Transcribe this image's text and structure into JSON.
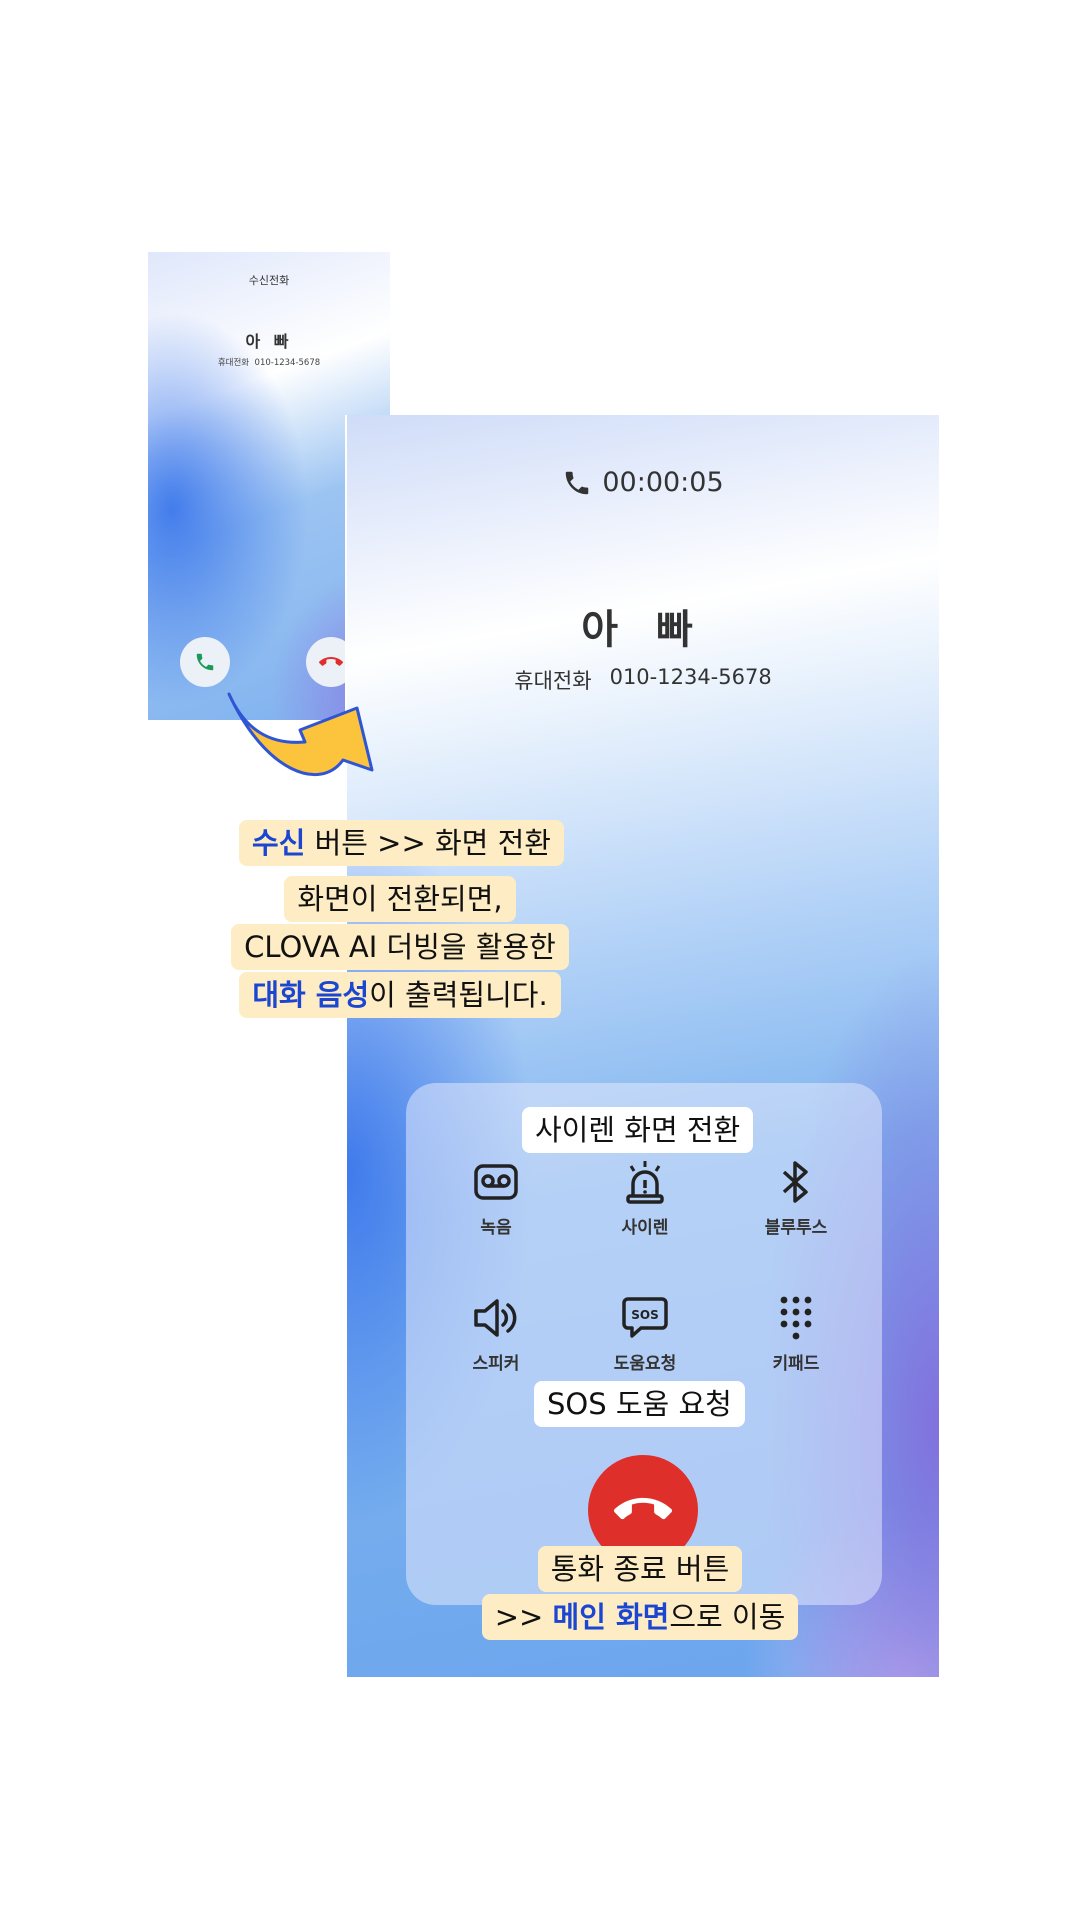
{
  "incoming": {
    "title": "수신전화",
    "caller_name": "아 빠",
    "number_type": "휴대전화",
    "number": "010-1234-5678",
    "icons": [
      "phone-accept-icon",
      "phone-decline-icon"
    ]
  },
  "call": {
    "timer": "00:00:05",
    "caller_name": "아 빠",
    "number_type": "휴대전화",
    "number": "010-1234-5678",
    "controls": [
      {
        "label": "녹음",
        "icon": "voicemail-icon"
      },
      {
        "label": "사이렌",
        "icon": "siren-icon"
      },
      {
        "label": "블루투스",
        "icon": "bluetooth-icon"
      },
      {
        "label": "스피커",
        "icon": "speaker-icon"
      },
      {
        "label": "도움요청",
        "icon": "sos-icon"
      },
      {
        "label": "키패드",
        "icon": "keypad-icon"
      }
    ],
    "end_icon": "hang-up-icon"
  },
  "annotations": {
    "accept": {
      "highlight": "수신",
      "rest": " 버튼 >> 화면 전환"
    },
    "transition": {
      "line1": "화면이 전환되면,",
      "line2": "CLOVA AI 더빙을 활용한",
      "line3_highlight": "대화 음성",
      "line3_rest": "이 출력됩니다."
    },
    "siren": "사이렌 화면 전환",
    "sos": "SOS 도움 요청",
    "end": {
      "line1": "통화 종료 버튼",
      "line2_prefix": ">> ",
      "line2_highlight": "메인 화면",
      "line2_rest": "으로 이동"
    }
  },
  "colors": {
    "highlight": "#1a46d2",
    "callout_bg": "#fdecc4",
    "end_button": "#df2f2a",
    "accept_icon": "#1a9a5a",
    "arrow_fill": "#fbc43c",
    "arrow_stroke": "#2f55d4"
  }
}
